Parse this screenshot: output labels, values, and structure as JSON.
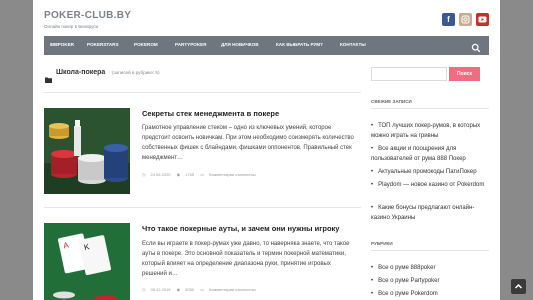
{
  "header": {
    "title": "POKER-CLUB.BY",
    "tagline": "Онлайн покер в Беларуси"
  },
  "nav": {
    "items": [
      "888POKER",
      "POKERSTARS",
      "POKEROM",
      "PARTYPOKER",
      "ДЛЯ НОВИЧКОВ",
      "КАК ВЫБРАТЬ РУМ?",
      "КОНТАКТЫ"
    ],
    "search_icon": "search-icon"
  },
  "archive": {
    "title": "Школа-покера",
    "count": "(записей в рубрике: 5)"
  },
  "posts": [
    {
      "title": "Секреты стек менеджмента в покере",
      "excerpt": "Грамотное управление стеком – одно из ключевых умений, которое предстоит освоить новичкам. При этом необходимо соизмерять количество собственных фишек с блайндами, фишками оппонентов. Правильный стек менеджмент…",
      "date": "24.06.2020",
      "views": "1765",
      "comments": "Комментарии отключены"
    },
    {
      "title": "Что такое покерные ауты, и зачем они нужны игроку",
      "excerpt": "Если вы играете в покер-румах уже давно, то наверняка знаете, что такое ауты в покере. Это основной показатель и термин покерной математики, который влияет на определение диапазона руки, принятие игровых решений и…",
      "date": "05.12.2019",
      "views": "3050",
      "comments": "Комментарии отключены"
    }
  ],
  "sidebar": {
    "search_button": "Поиск",
    "recent_title": "СВЕЖИЕ ЗАПИСИ",
    "recent": [
      "ТОП лучших покер-румов, в которых можно играть на гривны",
      "Все акции и поощрения для пользователей от рума 888 Покер",
      "Актуальные промокоды ПатиПокер",
      "Playdom — новое казино от Pokerdom",
      "Какие бонусы предлагают онлайн-казино Украины"
    ],
    "rubrics_title": "РУБРИКИ",
    "rubrics": [
      "Все о руме 888poker",
      "Все о руме Partypoker",
      "Все о руме Pokerdom"
    ]
  },
  "scroll_top_icon": "chevron-up-icon"
}
